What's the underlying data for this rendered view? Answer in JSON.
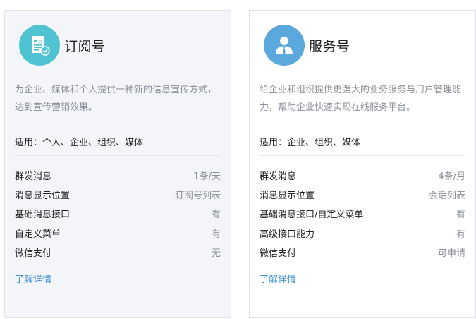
{
  "cards": [
    {
      "title": "订阅号",
      "icon": "subscription-doc-icon",
      "icon_color": "#4fc3d2",
      "description": "为企业、媒体和个人提供一种新的信息宣传方式，达到宣传营销效果。",
      "scope": "适用：个人、企业、组织、媒体",
      "rows": [
        {
          "label": "群发消息",
          "value": "1条/天"
        },
        {
          "label": "消息显示位置",
          "value": "订阅号列表"
        },
        {
          "label": "基础消息接口",
          "value": "有"
        },
        {
          "label": "自定义菜单",
          "value": "有"
        },
        {
          "label": "微信支付",
          "value": "无"
        }
      ],
      "link": "了解详情"
    },
    {
      "title": "服务号",
      "icon": "service-person-icon",
      "icon_color": "#5ba8dd",
      "description": "给企业和组织提供更强大的业务服务与用户管理能力，帮助企业快速实现在线服务平台。",
      "scope": "适用：企业、组织、媒体",
      "rows": [
        {
          "label": "群发消息",
          "value": "4条/月"
        },
        {
          "label": "消息显示位置",
          "value": "会话列表"
        },
        {
          "label": "基础消息接口/自定义菜单",
          "value": "有"
        },
        {
          "label": "高级接口能力",
          "value": "有"
        },
        {
          "label": "微信支付",
          "value": "可申请"
        }
      ],
      "link": "了解详情"
    }
  ]
}
